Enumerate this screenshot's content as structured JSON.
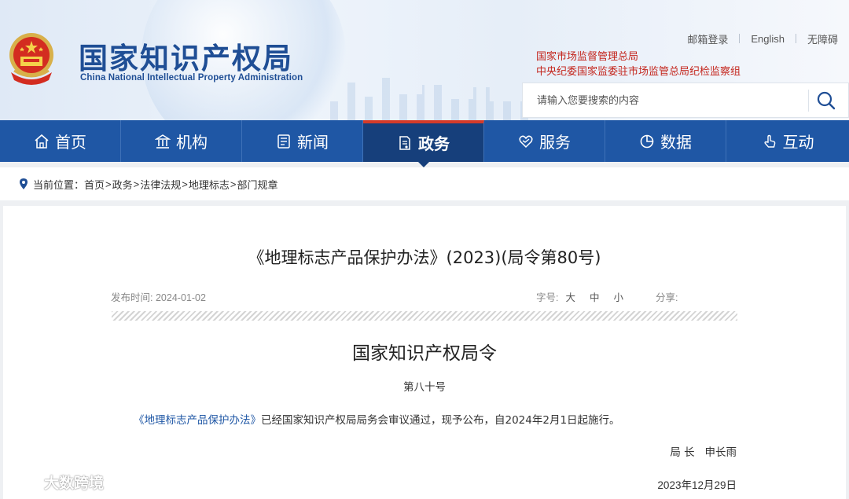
{
  "header": {
    "site_title_cn": "国家知识产权局",
    "site_title_en": "China National Intellectual Property Administration",
    "top_links": [
      "邮箱登录",
      "English",
      "无障碍"
    ],
    "parent_orgs": [
      "国家市场监督管理总局",
      "中央纪委国家监委驻市场监管总局纪检监察组"
    ],
    "search": {
      "placeholder": "请输入您要搜索的内容",
      "value": ""
    }
  },
  "nav": {
    "items": [
      {
        "label": "首页",
        "icon": "home-icon"
      },
      {
        "label": "机构",
        "icon": "institution-icon"
      },
      {
        "label": "新闻",
        "icon": "news-icon"
      },
      {
        "label": "政务",
        "icon": "government-affairs-icon",
        "active": true
      },
      {
        "label": "服务",
        "icon": "service-icon"
      },
      {
        "label": "数据",
        "icon": "data-chart-icon"
      },
      {
        "label": "互动",
        "icon": "interaction-hand-icon"
      }
    ],
    "colors": {
      "background": "#1f57a5",
      "active_background": "#163f7b",
      "active_border": "#d43b2a"
    }
  },
  "breadcrumb": {
    "label": "当前位置：",
    "items": [
      "首页",
      "政务",
      "法律法规",
      "地理标志",
      "部门规章"
    ],
    "separator": ">"
  },
  "article": {
    "title": "《地理标志产品保护办法》(2023)(局令第80号)",
    "publish_label": "发布时间:",
    "publish_date": "2024-01-02",
    "font_size_label": "字号:",
    "font_sizes": [
      "大",
      "中",
      "小"
    ],
    "share_label": "分享:",
    "decree_title": "国家知识产权局令",
    "decree_number": "第八十号",
    "body_link": "《地理标志产品保护办法》",
    "body_text": "已经国家知识产权局局务会审议通过，现予公布，自2024年2月1日起施行。",
    "signature": "局 长   申长雨",
    "sign_date": "2023年12月29日"
  },
  "watermark": {
    "text": "大数跨境"
  },
  "colors": {
    "brand_blue": "#1f4e95",
    "accent_red": "#c4261d"
  }
}
